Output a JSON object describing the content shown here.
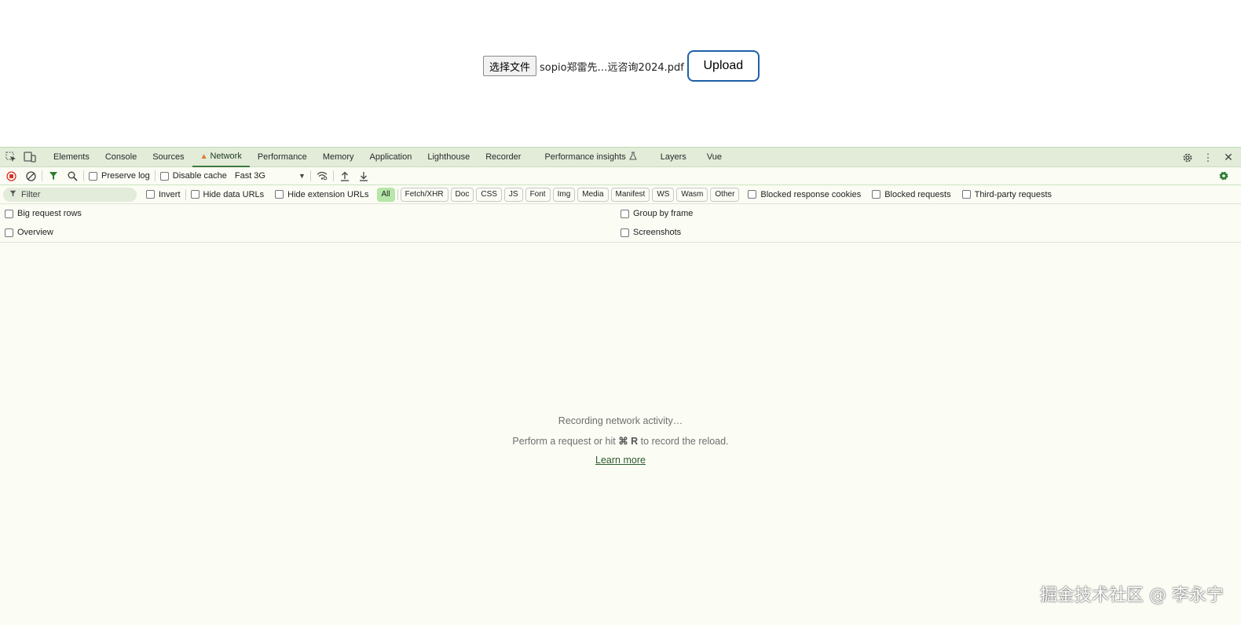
{
  "page": {
    "choose_file_label": "选择文件",
    "file_name": "sopio郑雷先…远咨询2024.pdf",
    "upload_label": "Upload"
  },
  "devtools": {
    "tabs": [
      "Elements",
      "Console",
      "Sources",
      "Network",
      "Performance",
      "Memory",
      "Application",
      "Lighthouse",
      "Recorder",
      "Performance insights",
      "Layers",
      "Vue"
    ],
    "active_tab": "Network",
    "toolbar": {
      "preserve_log": "Preserve log",
      "disable_cache": "Disable cache",
      "throttling": "Fast 3G"
    },
    "filter": {
      "placeholder": "Filter",
      "invert": "Invert",
      "hide_data_urls": "Hide data URLs",
      "hide_extension_urls": "Hide extension URLs",
      "types": [
        "All",
        "Fetch/XHR",
        "Doc",
        "CSS",
        "JS",
        "Font",
        "Img",
        "Media",
        "Manifest",
        "WS",
        "Wasm",
        "Other"
      ],
      "active_type": "All",
      "blocked_response_cookies": "Blocked response cookies",
      "blocked_requests": "Blocked requests",
      "third_party_requests": "Third-party requests"
    },
    "options": {
      "big_request_rows": "Big request rows",
      "group_by_frame": "Group by frame",
      "overview": "Overview",
      "screenshots": "Screenshots"
    },
    "empty": {
      "recording": "Recording network activity…",
      "hint_prefix": "Perform a request or hit ",
      "hint_key": "⌘ R",
      "hint_suffix": " to record the reload.",
      "learn_more": "Learn more"
    }
  },
  "watermark": "掘金技术社区 @ 李永宁",
  "colors": {
    "devtools_bg": "#fbfcf4",
    "tabbar_bg": "#e2ecd9",
    "active_chip": "#b6e6a8",
    "record_red": "#d93025",
    "upload_border": "#1e5fa8"
  }
}
